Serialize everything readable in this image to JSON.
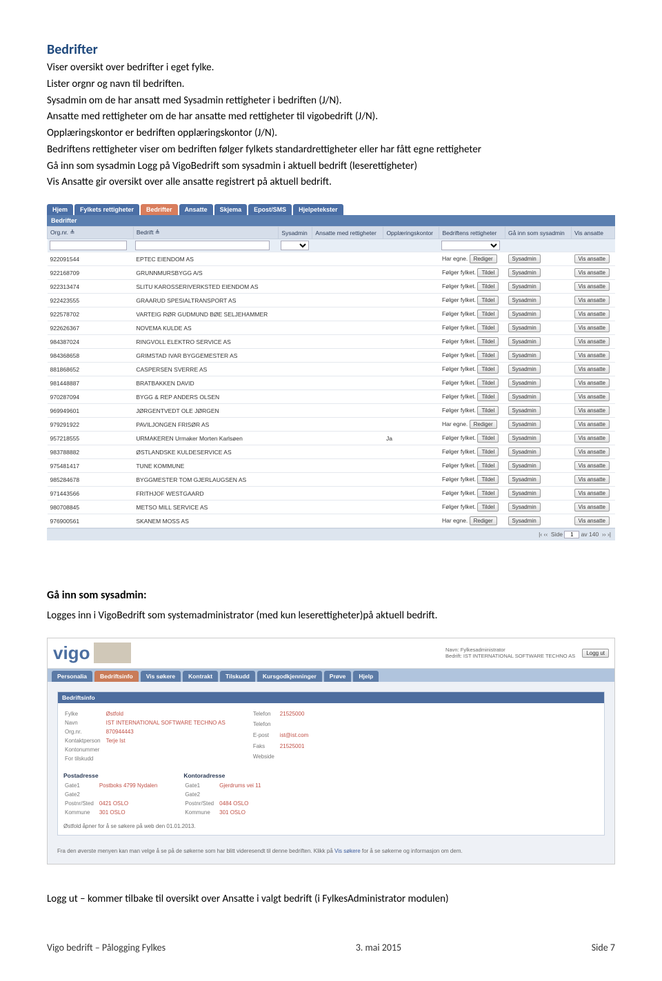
{
  "heading": "Bedrifter",
  "intro": [
    "Viser oversikt over bedrifter i eget fylke.",
    "Lister orgnr og navn til bedriften.",
    "Sysadmin om de har ansatt med Sysadmin rettigheter i bedriften (J/N).",
    "Ansatte med rettigheter om de har ansatte med rettigheter til vigobedrift (J/N).",
    "Opplæringskontor er bedriften opplæringskontor (J/N).",
    "Bedriftens rettigheter viser om bedriften følger fylkets standardrettigheter eller har fått egne rettigheter",
    "Gå inn som sysadmin Logg på VigoBedrift som sysadmin i aktuell bedrift (leserettigheter)",
    "Vis Ansatte gir oversikt over alle ansatte registrert på aktuell bedrift."
  ],
  "tabs1": [
    "Hjem",
    "Fylkets rettigheter",
    "Bedrifter",
    "Ansatte",
    "Skjema",
    "Epost/SMS",
    "Hjelpetekster"
  ],
  "tabs1_active": 2,
  "panel_title": "Bedrifter",
  "columns": [
    "Org.nr. ≜",
    "Bedrift ≜",
    "Sysadmin",
    "Ansatte med rettigheter",
    "Opplæringskontor",
    "Bedriftens rettigheter",
    "Gå inn som sysadmin",
    "Vis ansatte"
  ],
  "btn_rediger": "Rediger",
  "btn_tildel": "Tildel",
  "btn_sysadmin": "Sysadmin",
  "btn_vis": "Vis ansatte",
  "rows": [
    {
      "orgnr": "922091544",
      "navn": "EPTEC EIENDOM AS",
      "ja": "",
      "rett": "Har egne.",
      "btn": "Rediger"
    },
    {
      "orgnr": "922168709",
      "navn": "GRUNNMURSBYGG A/S",
      "ja": "",
      "rett": "Følger fylket.",
      "btn": "Tildel"
    },
    {
      "orgnr": "922313474",
      "navn": "SLITU KAROSSERIVERKSTED EIENDOM  AS",
      "ja": "",
      "rett": "Følger fylket.",
      "btn": "Tildel"
    },
    {
      "orgnr": "922423555",
      "navn": "GRAARUD SPESIALTRANSPORT AS",
      "ja": "",
      "rett": "Følger fylket.",
      "btn": "Tildel"
    },
    {
      "orgnr": "922578702",
      "navn": "VARTEIG RØR GUDMUND BØE SELJEHAMMER",
      "ja": "",
      "rett": "Følger fylket.",
      "btn": "Tildel"
    },
    {
      "orgnr": "922626367",
      "navn": "NOVEMA KULDE AS",
      "ja": "",
      "rett": "Følger fylket.",
      "btn": "Tildel"
    },
    {
      "orgnr": "984387024",
      "navn": "RINGVOLL ELEKTRO SERVICE AS",
      "ja": "",
      "rett": "Følger fylket.",
      "btn": "Tildel"
    },
    {
      "orgnr": "984368658",
      "navn": "GRIMSTAD IVAR BYGGEMESTER AS",
      "ja": "",
      "rett": "Følger fylket.",
      "btn": "Tildel"
    },
    {
      "orgnr": "881868652",
      "navn": "CASPERSEN SVERRE AS",
      "ja": "",
      "rett": "Følger fylket.",
      "btn": "Tildel"
    },
    {
      "orgnr": "981448887",
      "navn": "BRATBAKKEN DAVID",
      "ja": "",
      "rett": "Følger fylket.",
      "btn": "Tildel"
    },
    {
      "orgnr": "970287094",
      "navn": "BYGG & REP ANDERS OLSEN",
      "ja": "",
      "rett": "Følger fylket.",
      "btn": "Tildel"
    },
    {
      "orgnr": "969949601",
      "navn": "JØRGENTVEDT OLE JØRGEN",
      "ja": "",
      "rett": "Følger fylket.",
      "btn": "Tildel"
    },
    {
      "orgnr": "979291922",
      "navn": "PAVILJONGEN FRISØR AS",
      "ja": "",
      "rett": "Har egne.",
      "btn": "Rediger"
    },
    {
      "orgnr": "957218555",
      "navn": "URMAKEREN Urmaker Morten Karlsøen",
      "ja": "Ja",
      "rett": "Følger fylket.",
      "btn": "Tildel"
    },
    {
      "orgnr": "983788882",
      "navn": "ØSTLANDSKE KULDESERVICE AS",
      "ja": "",
      "rett": "Følger fylket.",
      "btn": "Tildel"
    },
    {
      "orgnr": "975481417",
      "navn": "TUNE KOMMUNE",
      "ja": "",
      "rett": "Følger fylket.",
      "btn": "Tildel"
    },
    {
      "orgnr": "985284678",
      "navn": "BYGGMESTER TOM GJERLAUGSEN AS",
      "ja": "",
      "rett": "Følger fylket.",
      "btn": "Tildel"
    },
    {
      "orgnr": "971443566",
      "navn": "FRITHJOF WESTGAARD",
      "ja": "",
      "rett": "Følger fylket.",
      "btn": "Tildel"
    },
    {
      "orgnr": "980708845",
      "navn": "METSO MILL SERVICE AS",
      "ja": "",
      "rett": "Følger fylket.",
      "btn": "Tildel"
    },
    {
      "orgnr": "976900561",
      "navn": "SKANEM MOSS AS",
      "ja": "",
      "rett": "Har egne.",
      "btn": "Rediger"
    }
  ],
  "pager": {
    "side_label": "Side",
    "page": "1",
    "av": "av 140",
    "arrows": "|‹ ‹‹  ››  ›|"
  },
  "section2_heading": "Gå inn som sysadmin:",
  "section2_text": "Logges inn i VigoBedrift som systemadministrator (med kun leserettigheter)på aktuell bedrift.",
  "vigo": {
    "logo_text": "vigo",
    "user_name_label": "Navn:",
    "user_name": "Fylkesadministrator",
    "user_bedrift_label": "Bedrift:",
    "user_bedrift": "IST INTERNATIONAL SOFTWARE TECHNO AS",
    "logout": "Logg ut"
  },
  "tabs2": [
    "Personalia",
    "Bedriftsinfo",
    "Vis søkere",
    "Kontrakt",
    "Tilskudd",
    "Kursgodkjenninger",
    "Prøve",
    "Hjelp"
  ],
  "tabs2_active": 1,
  "panel2_title": "Bedriftsinfo",
  "form_left": [
    {
      "label": "Fylke",
      "val": "Østfold"
    },
    {
      "label": "Navn",
      "val": "IST INTERNATIONAL SOFTWARE TECHNO AS"
    },
    {
      "label": "Org.nr.",
      "val": "870944443"
    },
    {
      "label": "Kontaktperson",
      "val": "Terje Ist"
    },
    {
      "label": "Kontonummer",
      "val": ""
    },
    {
      "label": "For tilskudd",
      "val": ""
    }
  ],
  "form_mid": [
    {
      "label": "Telefon",
      "val": "21525000"
    },
    {
      "label": "Telefon",
      "val": ""
    },
    {
      "label": "E-post",
      "val": "ist@ist.com"
    },
    {
      "label": "Faks",
      "val": "21525001"
    },
    {
      "label": "Webside",
      "val": ""
    }
  ],
  "post_heading": "Postadresse",
  "kontor_heading": "Kontoradresse",
  "post_rows": [
    {
      "label": "Gate1",
      "val": "Postboks 4799 Nydalen"
    },
    {
      "label": "Gate2",
      "val": ""
    },
    {
      "label": "Postnr/Sted",
      "val": "0421  OSLO"
    },
    {
      "label": "Kommune",
      "val": "301  OSLO"
    }
  ],
  "kontor_rows": [
    {
      "label": "Gate1",
      "val": "Gjerdrums vei 11"
    },
    {
      "label": "Gate2",
      "val": ""
    },
    {
      "label": "Postnr/Sted",
      "val": "0484  OSLO"
    },
    {
      "label": "Kommune",
      "val": "301  OSLO"
    }
  ],
  "open_note": "Østfold åpner for å se søkere på web den 01.01.2013.",
  "bottom_note_pre": "Fra den øverste menyen kan man velge å se på de søkerne som har blitt videresendt til denne bedriften. Klikk på ",
  "bottom_note_link": "Vis søkere",
  "bottom_note_post": " for å se søkerne og informasjon om dem.",
  "logout_line": "Logg ut – kommer tilbake til oversikt over Ansatte i valgt bedrift (i FylkesAdministrator modulen)",
  "footer": {
    "left": "Vigo bedrift – Pålogging Fylkes",
    "center": "3. mai 2015",
    "right": "Side 7"
  }
}
